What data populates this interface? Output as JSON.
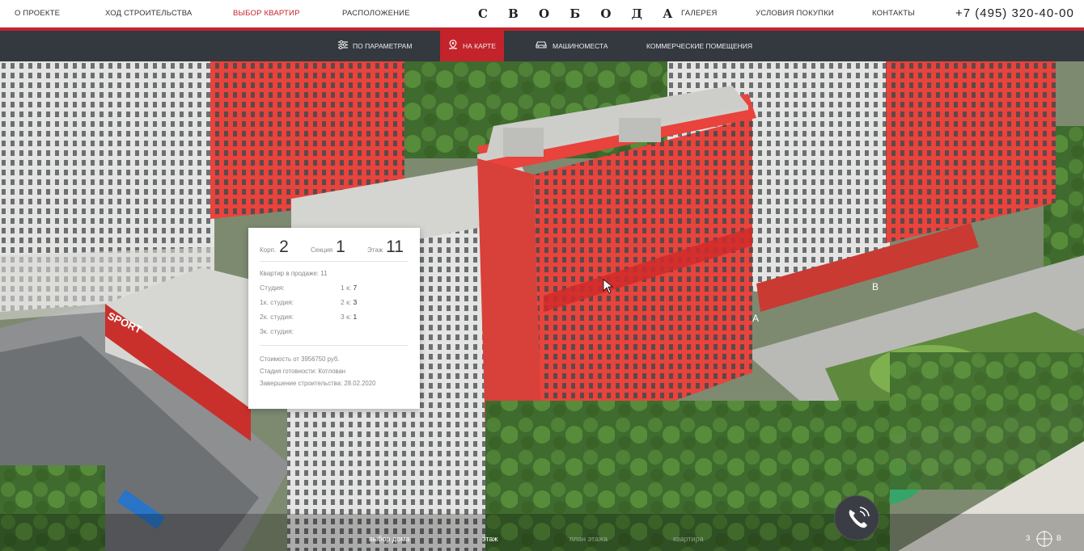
{
  "header": {
    "nav_left": [
      "О ПРОЕКТЕ",
      "ХОД СТРОИТЕЛЬСТВА",
      "ВЫБОР КВАРТИР",
      "РАСПОЛОЖЕНИЕ"
    ],
    "logo": "С В О Б О Д А",
    "nav_right": [
      "ГАЛЕРЕЯ",
      "УСЛОВИЯ ПОКУПКИ",
      "КОНТАКТЫ"
    ],
    "phone": "+7 (495) 320-40-00",
    "active_index": 2
  },
  "subnav": {
    "items": [
      "ПО ПАРАМЕТРАМ",
      "НА КАРТЕ",
      "МАШИНОМЕСТА",
      "КОММЕРЧЕСКИЕ ПОМЕЩЕНИЯ"
    ],
    "active_index": 1
  },
  "scene": {
    "sign_text": "SPORT",
    "building_labels": [
      "А",
      "В"
    ]
  },
  "card": {
    "korp_label": "Корп.",
    "korp_value": "2",
    "section_label": "Секция",
    "section_value": "1",
    "floor_label": "Этаж",
    "floor_value": "11",
    "sale_text": "Квартир в продаже: 11",
    "types_left": [
      "Студия:",
      "1к. студия:",
      "2к. студия:",
      "3к. студия:"
    ],
    "types_right_labels": [
      "1 к:",
      "2 к:",
      "3 к:"
    ],
    "types_right_values": [
      "7",
      "3",
      "1"
    ],
    "price": "Стоимость от 3956750 руб.",
    "stage": "Стадия готовности: Котлован",
    "completion": "Завершение строительства: 28.02.2020"
  },
  "steps": [
    "выбор дома",
    "этаж",
    "план этажа",
    "квартира"
  ],
  "compass": {
    "left": "З",
    "right": "В"
  },
  "colors": {
    "accent": "#c4232b",
    "subnav_bg": "#34383f",
    "building_red": "#e8403a"
  }
}
